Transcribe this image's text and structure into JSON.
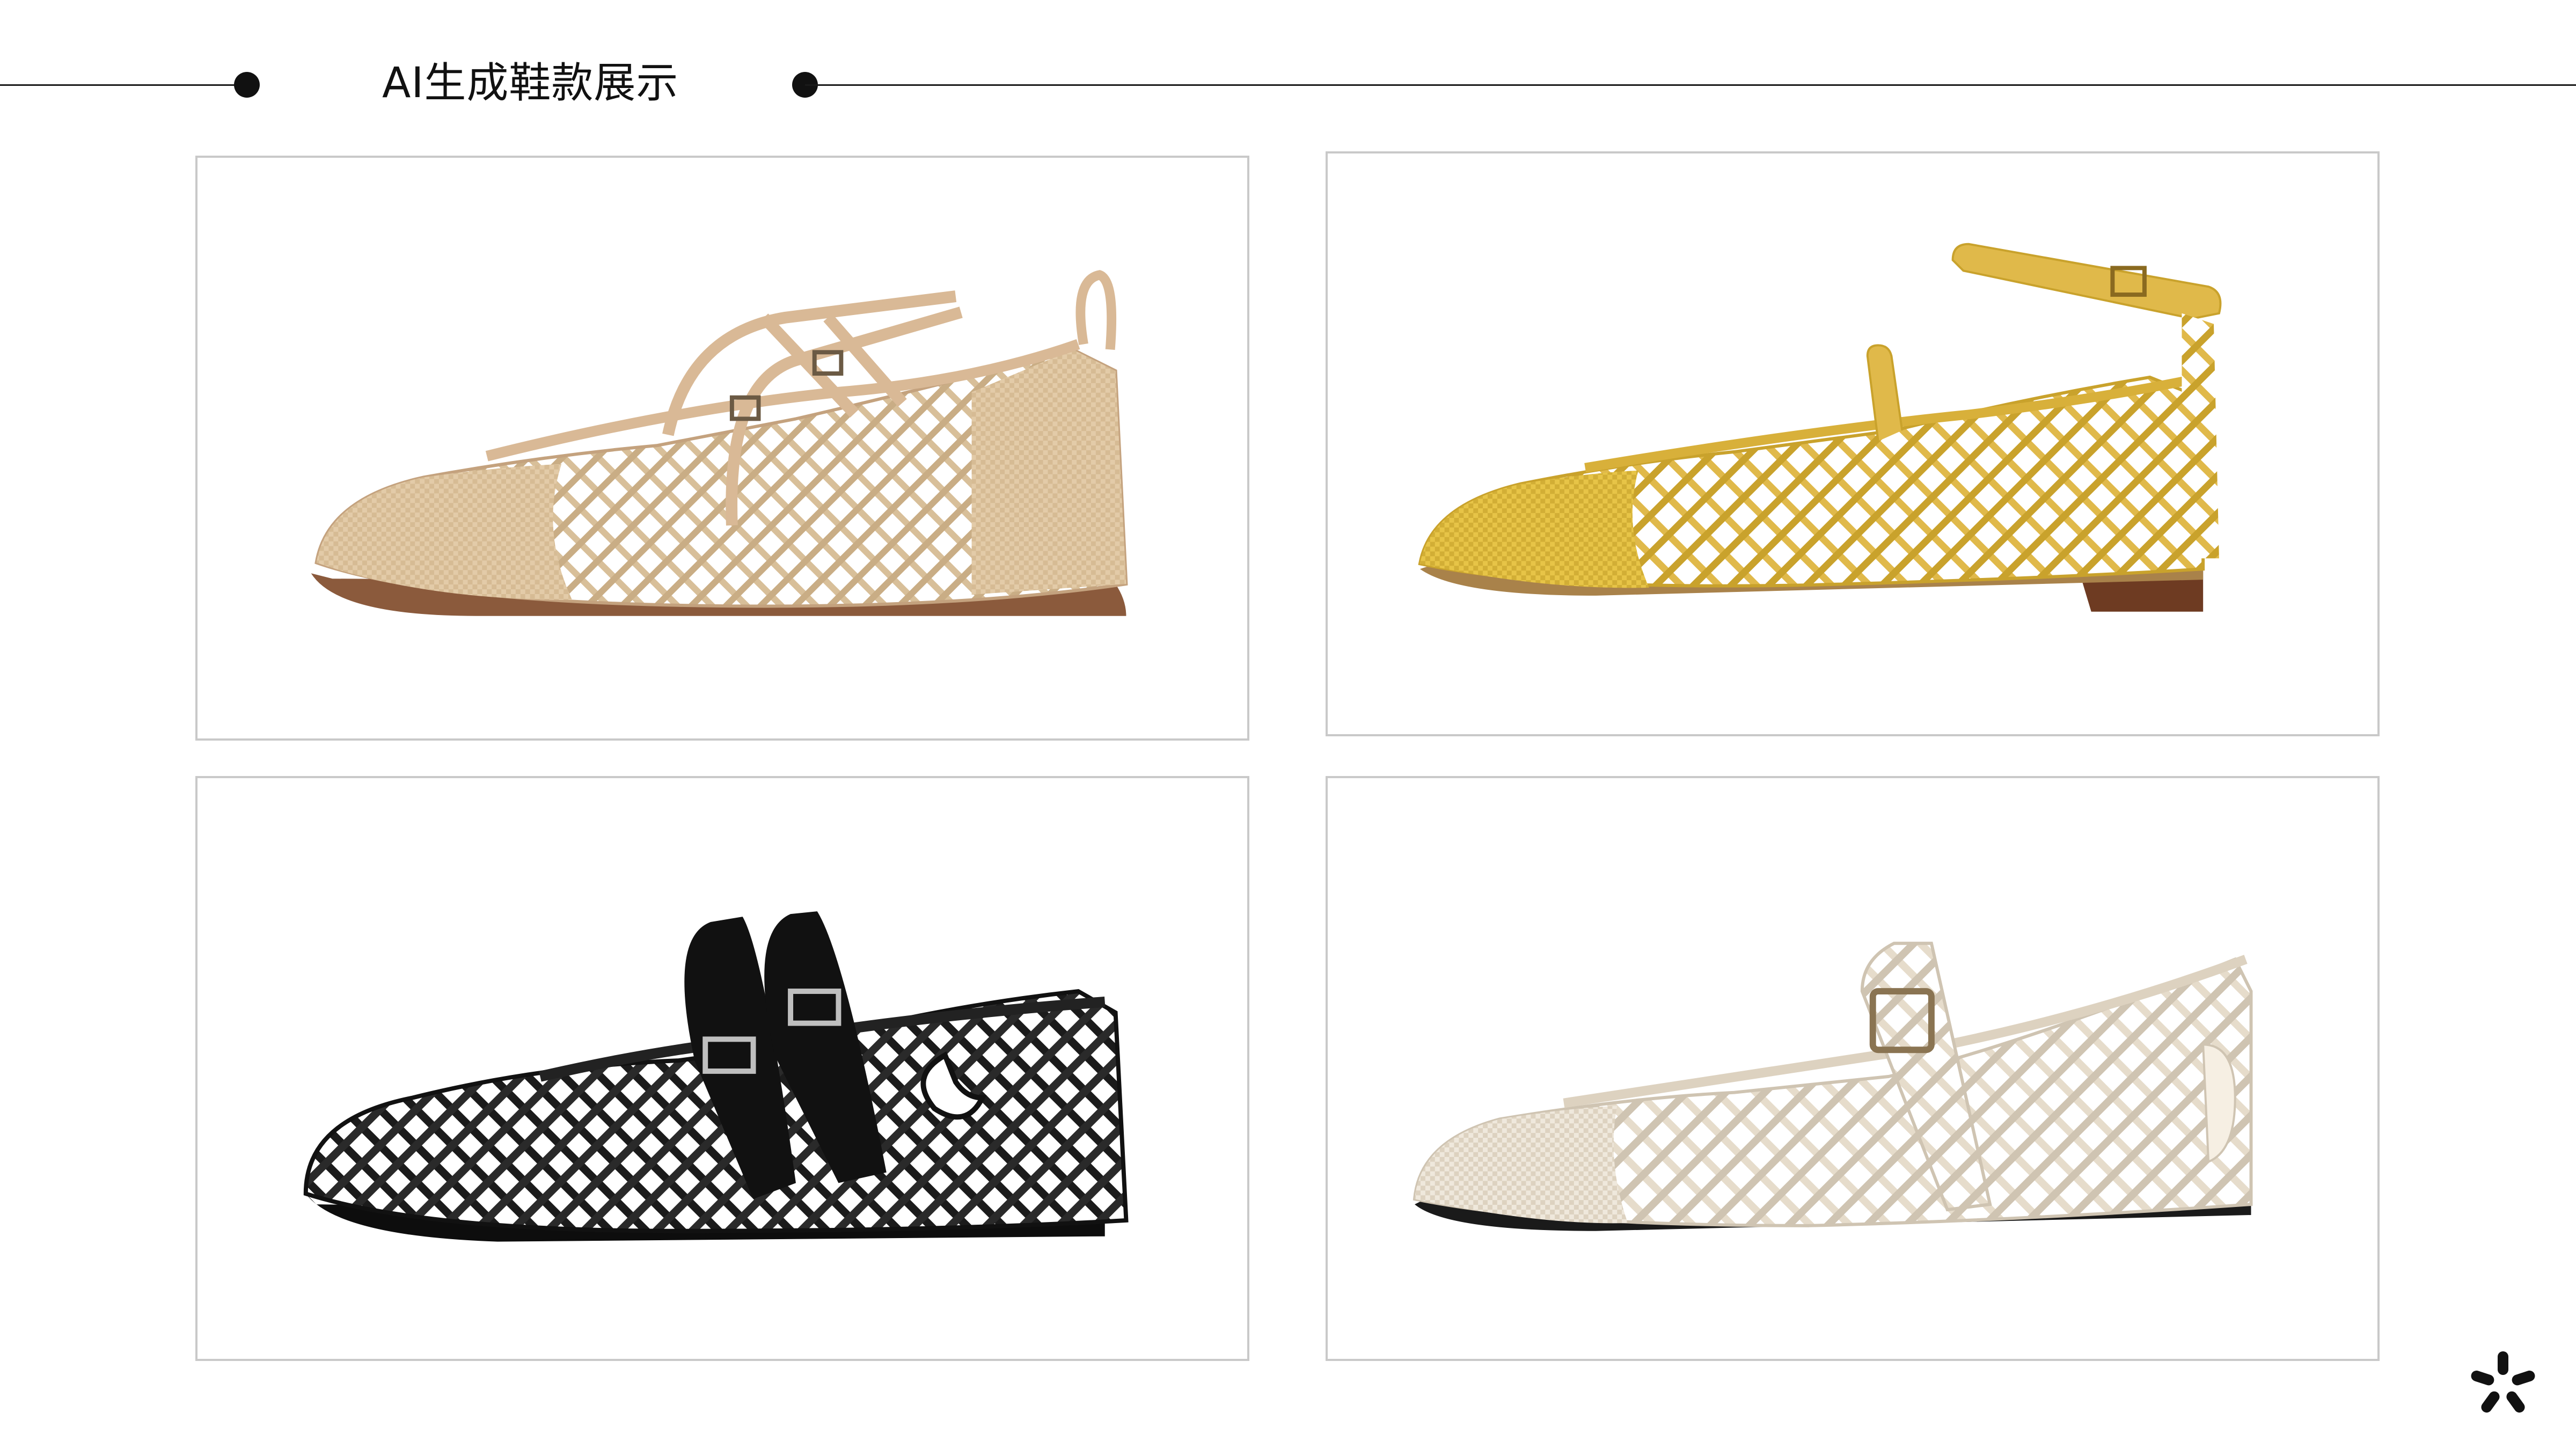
{
  "header": {
    "title": "AI生成鞋款展示"
  },
  "gallery": {
    "items": [
      {
        "icon": "natural-woven-mary-jane-shoe-icon",
        "colors": {
          "upper": "#e3cba8",
          "weave": "#c9ad85",
          "strap": "#d9b996",
          "sole": "#8b5a3c"
        }
      },
      {
        "icon": "yellow-woven-ankle-strap-shoe-icon",
        "colors": {
          "upper": "#e7c447",
          "weave": "#c9a22c",
          "strap": "#e0b94a",
          "sole": "#6e3b22"
        }
      },
      {
        "icon": "black-woven-double-buckle-shoe-icon",
        "colors": {
          "upper": "#1b1b1b",
          "weave": "#3a3a3a",
          "strap": "#111111",
          "sole": "#0d0d0d"
        }
      },
      {
        "icon": "cream-woven-buckle-shoe-icon",
        "colors": {
          "upper": "#efe8dc",
          "weave": "#cfc4b2",
          "strap": "#e6dccb",
          "sole": "#1a1a1a"
        }
      }
    ]
  },
  "brand": {
    "icon": "brand-logo-icon",
    "color": "#111111"
  }
}
